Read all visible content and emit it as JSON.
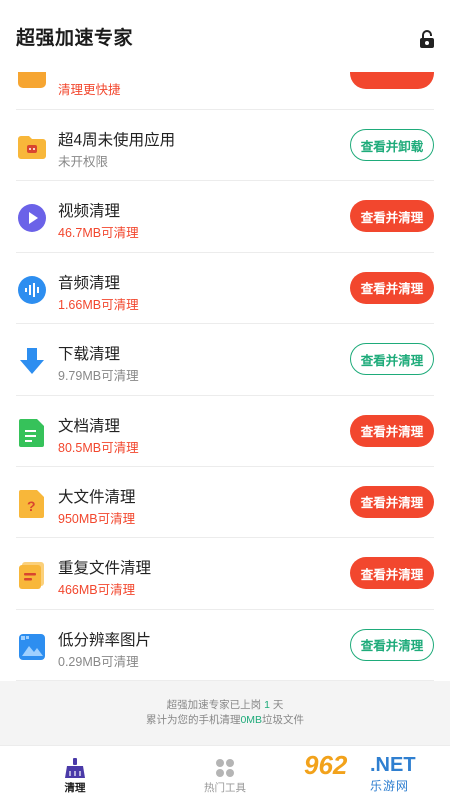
{
  "header": {
    "title": "超强加速专家",
    "lock_icon": "lock-open-icon"
  },
  "items": [
    {
      "name": "",
      "sub": "清理更快捷",
      "sub_color": "red",
      "button": "",
      "button_style": "red",
      "icon": "app-icon",
      "partial": true
    },
    {
      "name": "超4周未使用应用",
      "sub": "未开权限",
      "sub_color": "gray",
      "button": "查看并卸载",
      "button_style": "green",
      "icon": "folder-app-icon"
    },
    {
      "name": "视频清理",
      "sub": "46.7MB可清理",
      "sub_color": "red",
      "button": "查看并清理",
      "button_style": "red",
      "icon": "video-icon"
    },
    {
      "name": "音频清理",
      "sub": "1.66MB可清理",
      "sub_color": "red",
      "button": "查看并清理",
      "button_style": "red",
      "icon": "audio-icon"
    },
    {
      "name": "下载清理",
      "sub": "9.79MB可清理",
      "sub_color": "gray",
      "button": "查看并清理",
      "button_style": "green",
      "icon": "download-icon"
    },
    {
      "name": "文档清理",
      "sub": "80.5MB可清理",
      "sub_color": "red",
      "button": "查看并清理",
      "button_style": "red",
      "icon": "document-icon"
    },
    {
      "name": "大文件清理",
      "sub": "950MB可清理",
      "sub_color": "red",
      "button": "查看并清理",
      "button_style": "red",
      "icon": "large-file-icon"
    },
    {
      "name": "重复文件清理",
      "sub": "466MB可清理",
      "sub_color": "red",
      "button": "查看并清理",
      "button_style": "red",
      "icon": "duplicate-file-icon"
    },
    {
      "name": "低分辨率图片",
      "sub": "0.29MB可清理",
      "sub_color": "gray",
      "button": "查看并清理",
      "button_style": "green",
      "icon": "image-icon"
    }
  ],
  "footer": {
    "line1_prefix": "超强加速专家已上岗",
    "days": "1",
    "line1_suffix": "天",
    "line2_prefix": "累计为您的手机清理",
    "cleaned": "0MB",
    "line2_suffix": "垃圾文件"
  },
  "tabs": [
    {
      "label": "清理",
      "icon": "broom-icon",
      "active": true
    },
    {
      "label": "热门工具",
      "icon": "tools-grid-icon",
      "active": false
    }
  ],
  "watermark": {
    "num": "962",
    "net": ".NET",
    "sub": "乐游网"
  },
  "colors": {
    "accent_red": "#f2472e",
    "accent_green": "#1eab7a"
  }
}
